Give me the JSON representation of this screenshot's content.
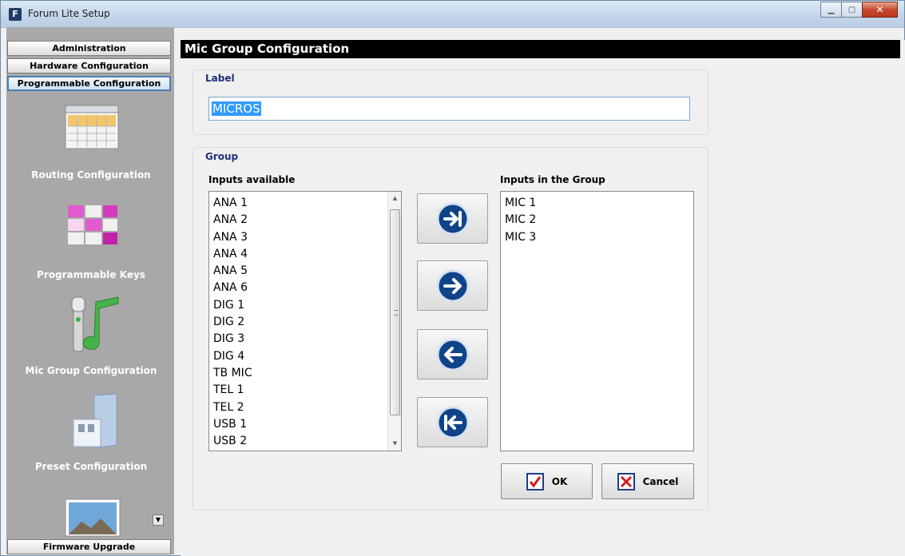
{
  "window": {
    "title": "Forum Lite Setup",
    "app_icon": "F"
  },
  "nav": {
    "top_buttons": [
      "Administration",
      "Hardware Configuration",
      "Programmable Configuration"
    ],
    "items": [
      {
        "label": "Routing Configuration",
        "icon": "grid-table-icon"
      },
      {
        "label": "Programmable Keys",
        "icon": "keys-icon"
      },
      {
        "label": "Mic Group Configuration",
        "icon": "mic-music-icon"
      },
      {
        "label": "Preset Configuration",
        "icon": "folder-icon"
      },
      {
        "label": "",
        "icon": "photo-icon"
      }
    ],
    "bottom_button": "Firmware Upgrade"
  },
  "header": {
    "title": "Mic Group Configuration"
  },
  "label_section": {
    "title": "Label",
    "value": "MICROS"
  },
  "group_section": {
    "title": "Group",
    "available_label": "Inputs available",
    "available": [
      "ANA 1",
      "ANA 2",
      "ANA 3",
      "ANA 4",
      "ANA 5",
      "ANA 6",
      "DIG 1",
      "DIG 2",
      "DIG 3",
      "DIG 4",
      "TB MIC",
      "TEL 1",
      "TEL 2",
      "USB 1",
      "USB 2"
    ],
    "group_label": "Inputs in the Group",
    "in_group": [
      "MIC 1",
      "MIC 2",
      "MIC 3"
    ]
  },
  "buttons": {
    "ok": "OK",
    "cancel": "Cancel"
  },
  "colors": {
    "accent": "#1e2f7a",
    "header_bg": "#000000",
    "selection": "#3399ff"
  }
}
